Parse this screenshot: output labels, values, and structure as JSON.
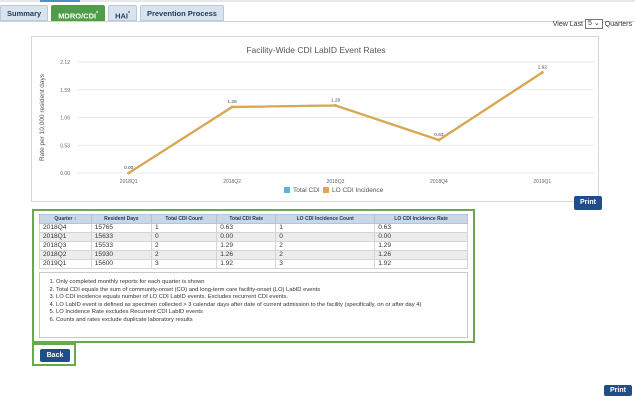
{
  "tabs": [
    {
      "label": "Summary"
    },
    {
      "label": "MDRO/CDI",
      "marker": "*"
    },
    {
      "label": "HAI",
      "marker": "*"
    },
    {
      "label": "Prevention Process"
    }
  ],
  "view_last": {
    "prefix": "View Last",
    "value": "5",
    "suffix": "Quarters"
  },
  "chart_data": {
    "type": "line",
    "title": "Facility-Wide CDI LabID Event Rates",
    "ylabel": "Rate per 10,000 resident days",
    "xlabel": "",
    "categories": [
      "2018Q1",
      "2018Q2",
      "2018Q3",
      "2018Q4",
      "2019Q1"
    ],
    "yticks": [
      "2.12",
      "1.59",
      "1.06",
      "0.53",
      "0.00"
    ],
    "ylim": [
      0,
      2.12
    ],
    "series": [
      {
        "name": "Total CDI",
        "values": [
          0.0,
          1.26,
          1.29,
          0.63,
          1.92
        ],
        "color": "#5bb5d6"
      },
      {
        "name": "LO CDI Incidence",
        "values": [
          0.0,
          1.26,
          1.29,
          0.63,
          1.92
        ],
        "color": "#e0a64a"
      }
    ],
    "data_labels": [
      "0.00",
      "1.26",
      "1.29",
      "0.63",
      "1.92"
    ],
    "grid": true,
    "legend_position": "bottom"
  },
  "print_label": "Print",
  "table": {
    "headers": [
      "Quarter",
      "Resident Days",
      "Total CDI Count",
      "Total CDI Rate",
      "LO CDI Incidence Count",
      "LO CDI Incidence Rate"
    ],
    "sort_indicator": "↕",
    "rows": [
      [
        "2018Q4",
        "15765",
        "1",
        "0.63",
        "1",
        "0.63"
      ],
      [
        "2018Q1",
        "15633",
        "0",
        "0.00",
        "0",
        "0.00"
      ],
      [
        "2018Q3",
        "15533",
        "2",
        "1.29",
        "2",
        "1.29"
      ],
      [
        "2018Q2",
        "15930",
        "2",
        "1.26",
        "2",
        "1.26"
      ],
      [
        "2019Q1",
        "15600",
        "3",
        "1.92",
        "3",
        "1.92"
      ]
    ]
  },
  "notes": [
    "Only completed monthly reports for each quarter is shown",
    "Total CDI equals the sum of community-onset (CO) and long-term care facility-onset (LO) LabID events",
    "LO CDI incidence equals number of LO CDI LabID events. Excludes recurrent CDI events.",
    "LO LabID event is defined as specimen collected > 3 calendar days after date of current admission to the facility (specifically, on or after day 4)",
    "LO Incidence Rate excludes Recurrent CDI LabID events",
    "Counts and rates exclude duplicate laboratory results"
  ],
  "back_label": "Back"
}
